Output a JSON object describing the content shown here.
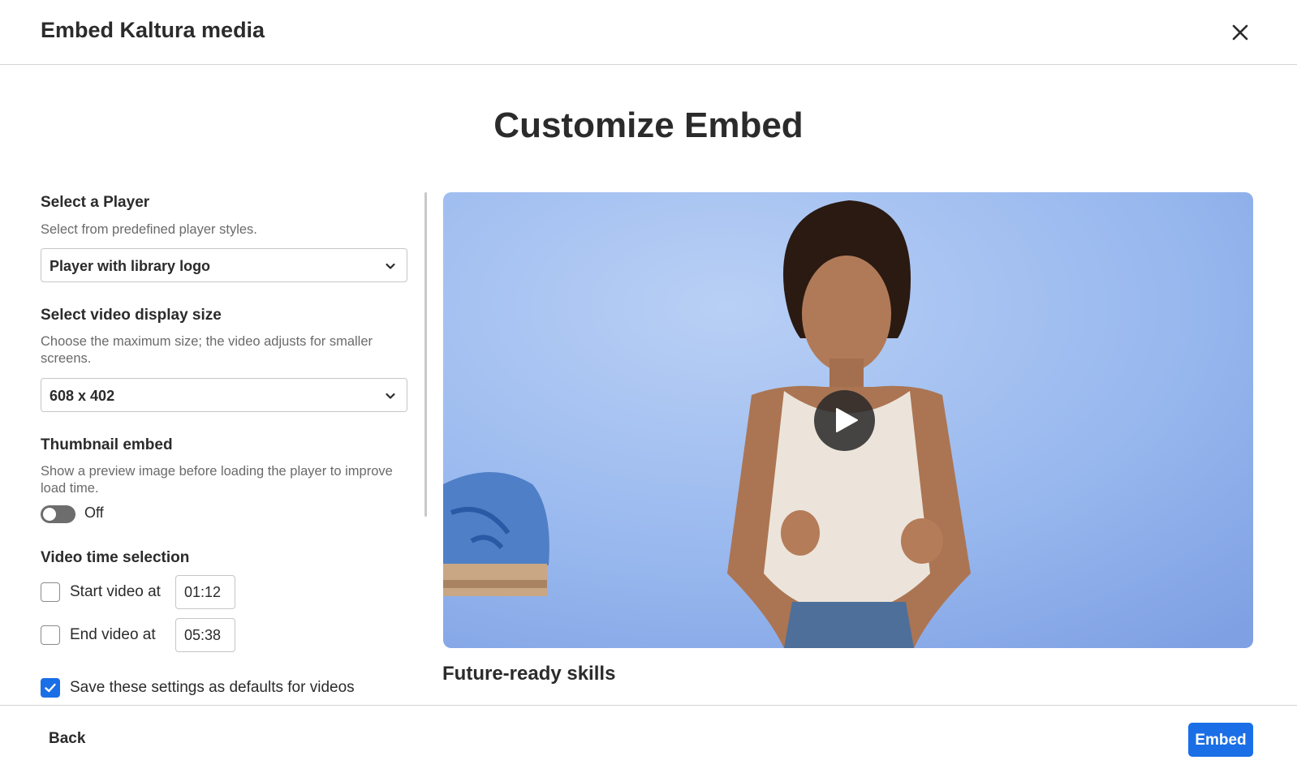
{
  "header": {
    "title": "Embed Kaltura media",
    "close_icon": "close-icon"
  },
  "page_title": "Customize Embed",
  "player": {
    "label": "Select a Player",
    "description": "Select from predefined player styles.",
    "selected": "Player with library logo"
  },
  "display_size": {
    "label": "Select video display size",
    "description": "Choose the maximum size; the video adjusts for smaller screens.",
    "selected": "608 x 402"
  },
  "thumbnail": {
    "label": "Thumbnail embed",
    "description": "Show a preview image before loading the player to improve load time.",
    "toggle_state": "Off"
  },
  "time_selection": {
    "label": "Video time selection",
    "start_label": "Start video at",
    "start_value": "01:12",
    "start_checked": false,
    "end_label": "End video at",
    "end_value": "05:38",
    "end_checked": false
  },
  "save_defaults": {
    "label": "Save these settings as defaults for videos",
    "checked": true
  },
  "video": {
    "title": "Future-ready skills",
    "play_icon": "play-icon"
  },
  "footer": {
    "back_label": "Back",
    "embed_label": "Embed"
  },
  "colors": {
    "accent": "#1a6fe6",
    "toggle_off": "#6d6d6d",
    "video_bg": "#8fb0ea"
  }
}
